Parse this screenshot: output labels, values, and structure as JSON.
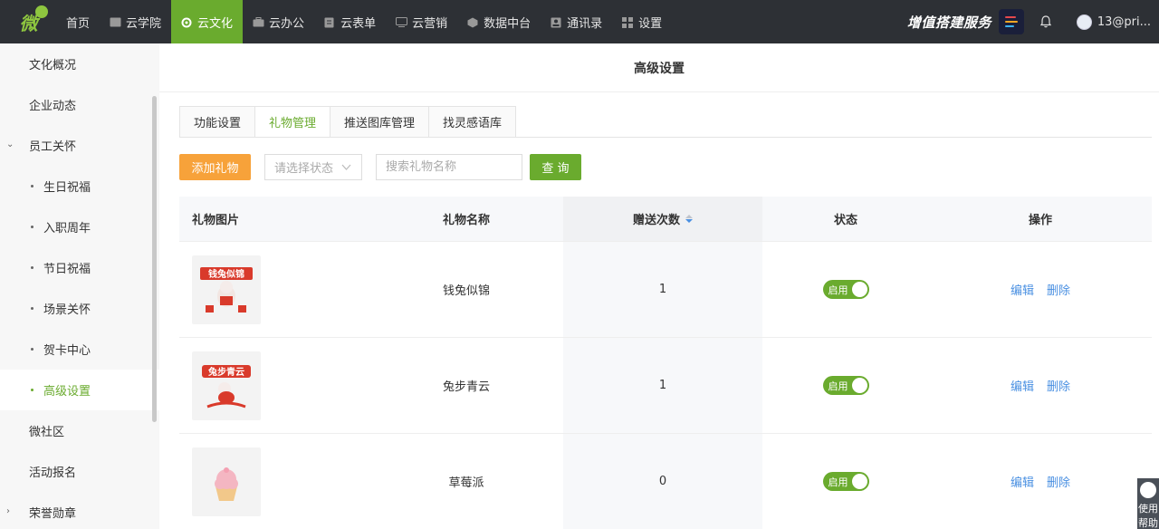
{
  "nav": {
    "items": [
      {
        "label": "首页",
        "icon": ""
      },
      {
        "label": "云学院",
        "icon": "book-icon"
      },
      {
        "label": "云文化",
        "icon": "gear-icon",
        "active": true
      },
      {
        "label": "云办公",
        "icon": "briefcase-icon"
      },
      {
        "label": "云表单",
        "icon": "form-icon"
      },
      {
        "label": "云营销",
        "icon": "monitor-icon"
      },
      {
        "label": "数据中台",
        "icon": "cube-icon"
      },
      {
        "label": "通讯录",
        "icon": "contact-icon"
      },
      {
        "label": "设置",
        "icon": "grid-icon"
      }
    ],
    "promo": "增值搭建服务",
    "user": "13@pri..."
  },
  "sidebar": {
    "items": [
      {
        "label": "文化概况"
      },
      {
        "label": "企业动态"
      },
      {
        "label": "员工关怀"
      },
      {
        "label": "生日祝福"
      },
      {
        "label": "入职周年"
      },
      {
        "label": "节日祝福"
      },
      {
        "label": "场景关怀"
      },
      {
        "label": "贺卡中心"
      },
      {
        "label": "高级设置"
      },
      {
        "label": "微社区"
      },
      {
        "label": "活动报名"
      },
      {
        "label": "荣誉勋章"
      }
    ]
  },
  "page": {
    "title": "高级设置",
    "tabs": [
      "功能设置",
      "礼物管理",
      "推送图库管理",
      "找灵感语库"
    ]
  },
  "toolbar": {
    "add_label": "添加礼物",
    "status_placeholder": "请选择状态",
    "search_placeholder": "搜索礼物名称",
    "query_label": "查 询"
  },
  "table": {
    "headers": [
      "礼物图片",
      "礼物名称",
      "赠送次数",
      "状态",
      "操作"
    ],
    "rows": [
      {
        "name": "钱兔似锦",
        "count": "1",
        "status": "启用",
        "thumb_text": "钱兔似锦"
      },
      {
        "name": "兔步青云",
        "count": "1",
        "status": "启用",
        "thumb_text": "兔步青云"
      },
      {
        "name": "草莓派",
        "count": "0",
        "status": "启用",
        "thumb_text": ""
      }
    ],
    "edit_label": "编辑",
    "delete_label": "删除"
  },
  "help": {
    "label": "使用帮助"
  },
  "colors": {
    "accent": "#6aab2e",
    "orange": "#f7a23a",
    "link": "#4a90e2",
    "nav_bg": "#2d3035"
  }
}
